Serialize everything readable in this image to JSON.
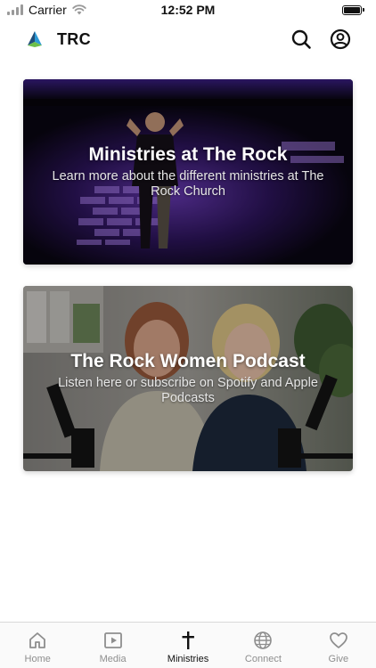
{
  "status_bar": {
    "carrier": "Carrier",
    "time": "12:52 PM"
  },
  "header": {
    "title": "TRC",
    "icons": [
      "search-icon",
      "account-icon"
    ]
  },
  "cards": [
    {
      "title": "Ministries at The Rock",
      "subtitle": "Learn more about the different ministries at The Rock Church"
    },
    {
      "title": "The Rock Women Podcast",
      "subtitle": "Listen here or subscribe on Spotify and Apple Podcasts"
    }
  ],
  "tab_bar": {
    "items": [
      {
        "label": "Home",
        "icon": "home-icon"
      },
      {
        "label": "Media",
        "icon": "play-icon"
      },
      {
        "label": "Ministries",
        "icon": "cross-icon",
        "active": true
      },
      {
        "label": "Connect",
        "icon": "globe-icon"
      },
      {
        "label": "Give",
        "icon": "heart-icon"
      }
    ]
  },
  "colors": {
    "active_tab": "#111111",
    "inactive_tab": "#8e8e8e",
    "stage_light": "#7b3fe0"
  }
}
